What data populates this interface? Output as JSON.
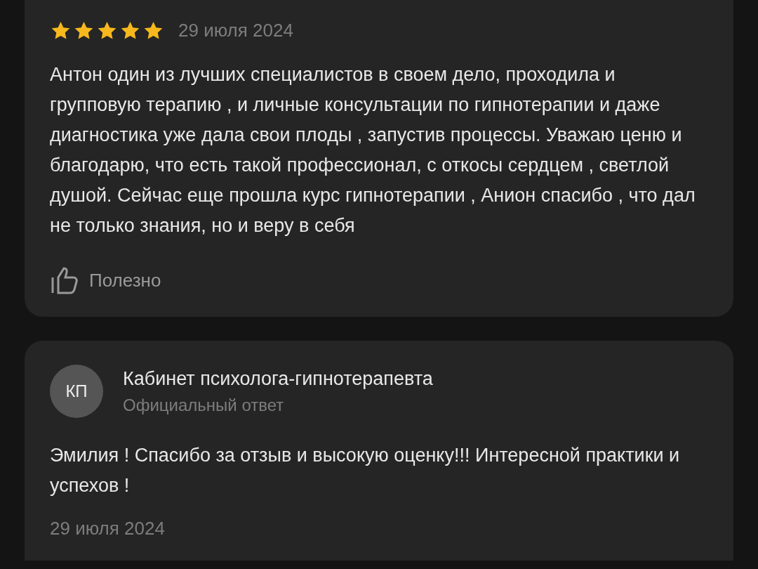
{
  "review": {
    "stars": 5,
    "date": "29 июля 2024",
    "text": "Антон один из лучших специалистов в своем дело, проходила и групповую терапию , и личные консультации по гипнотерапии и даже диагностика уже дала свои плоды , запустив процессы. Уважаю ценю и благодарю, что есть такой профессионал, с откосы сердцем , светлой душой. Сейчас еще прошла курс гипнотерапии , Анион спасибо , что дал не только знания, но и веру в себя",
    "helpful_label": "Полезно"
  },
  "reply": {
    "avatar_initials": "КП",
    "author": "Кабинет психолога-гипнотерапевта",
    "role": "Официальный ответ",
    "text": "Эмилия ! Спасибо за отзыв и высокую оценку!!! Интересной практики и успехов !",
    "date": "29 июля 2024"
  }
}
